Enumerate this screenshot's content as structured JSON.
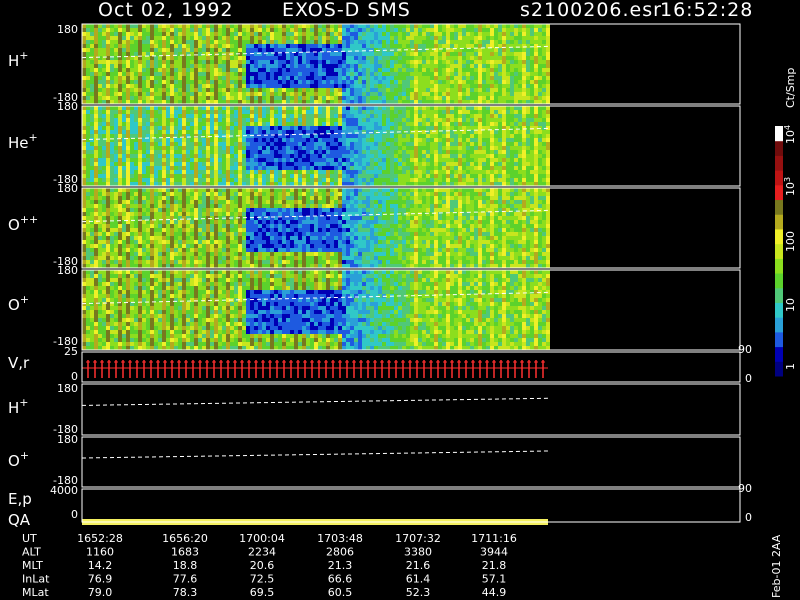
{
  "header": {
    "date": "Oct 02, 1992",
    "instrument": "EXOS-D SMS",
    "file": "s2100206.esr",
    "time": "16:52:28"
  },
  "colors": {
    "background": "#000000",
    "frame": "#ffffff",
    "trace": "#ffffff",
    "vr_marks": "#ff3030",
    "qa_bar": "#f4f060"
  },
  "colorbar": {
    "title": "Ct/Smp",
    "ticks": [
      "10^4",
      "10^3",
      "100",
      "10",
      "1"
    ],
    "colors": [
      "#000080",
      "#0000b4",
      "#1e5ae0",
      "#2aa0d8",
      "#30c8c8",
      "#50c878",
      "#5cd22c",
      "#8cde1e",
      "#c8e61e",
      "#f0f028",
      "#b4aa1e",
      "#78781e",
      "#e61e1e",
      "#be1414",
      "#961010",
      "#700c0c",
      "#ffffff"
    ]
  },
  "chart_data": {
    "type": "heatmap",
    "title": "Oct 02, 1992 EXOS-D SMS",
    "x_axis": {
      "label": "UT",
      "ticks": [
        "1652:28",
        "1656:20",
        "1700:04",
        "1703:48",
        "1707:32",
        "1711:16"
      ]
    },
    "panels": [
      {
        "label": "H",
        "sup": "+",
        "kind": "spectrogram",
        "ymin": "-180",
        "ymax": "180"
      },
      {
        "label": "He",
        "sup": "+",
        "kind": "spectrogram",
        "ymin": "-180",
        "ymax": "180"
      },
      {
        "label": "O",
        "sup": "++",
        "kind": "spectrogram",
        "ymin": "-180",
        "ymax": "180"
      },
      {
        "label": "O",
        "sup": "+",
        "kind": "spectrogram",
        "ymin": "-180",
        "ymax": "180"
      },
      {
        "label": "V,r",
        "sup": "",
        "kind": "vr",
        "left_top": "25",
        "left_bottom": "0",
        "right_top": "90",
        "right_bottom": "0"
      },
      {
        "label": "H",
        "sup": "+",
        "kind": "trace",
        "ymin": "-180",
        "ymax": "180"
      },
      {
        "label": "O",
        "sup": "+",
        "kind": "trace",
        "ymin": "-180",
        "ymax": "180"
      },
      {
        "label": "E,p",
        "label2": "QA",
        "kind": "ep",
        "left_top": "4000",
        "left_bottom": "0",
        "right_top": "90",
        "right_bottom": "0"
      }
    ],
    "orbit_table": {
      "rows": [
        {
          "name": "UT",
          "values": [
            "1652:28",
            "1656:20",
            "1700:04",
            "1703:48",
            "1707:32",
            "1711:16"
          ]
        },
        {
          "name": "ALT",
          "values": [
            "1160",
            "1683",
            "2234",
            "2806",
            "3380",
            "3944"
          ]
        },
        {
          "name": "MLT",
          "values": [
            "14.2",
            "18.8",
            "20.6",
            "21.3",
            "21.6",
            "21.8"
          ]
        },
        {
          "name": "InLat",
          "values": [
            "76.9",
            "77.6",
            "72.5",
            "66.6",
            "61.4",
            "57.1"
          ]
        },
        {
          "name": "MLat",
          "values": [
            "79.0",
            "78.3",
            "69.5",
            "60.5",
            "52.3",
            "44.9"
          ]
        }
      ]
    }
  },
  "footer_note": "Feb-01 2AA"
}
